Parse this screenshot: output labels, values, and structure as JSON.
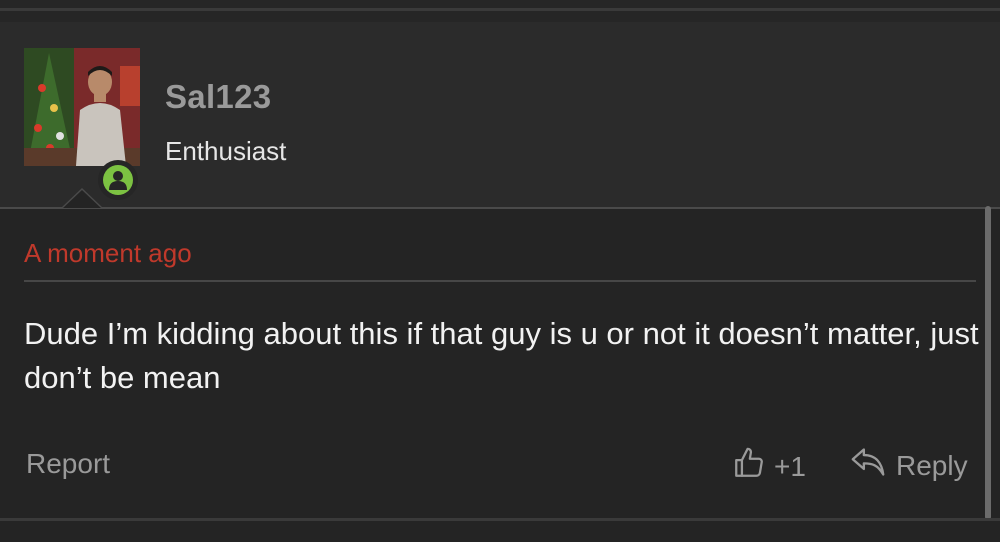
{
  "user": {
    "name": "Sal123",
    "title": "Enthusiast",
    "status_color": "#7cc242"
  },
  "post": {
    "timestamp": "A moment ago",
    "body": "Dude I’m kidding about this if that guy is u or not it doesn’t matter, just don’t be mean"
  },
  "actions": {
    "report_label": "Report",
    "like_count": "+1",
    "reply_label": "Reply"
  },
  "colors": {
    "accent": "#c0392b",
    "background": "#242424"
  }
}
